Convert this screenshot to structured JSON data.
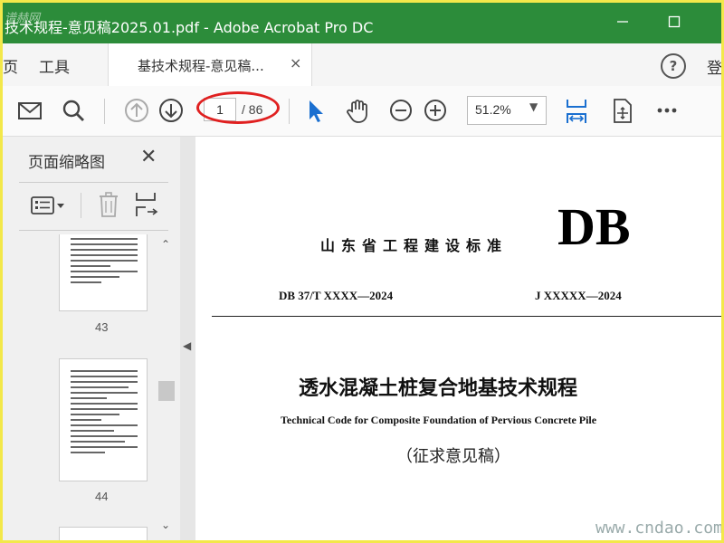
{
  "window": {
    "title": "技术规程-意见稿2025.01.pdf - Adobe Acrobat Pro DC",
    "watermark_top": "谱赫网"
  },
  "tabs": {
    "home": "页",
    "tools": "工具",
    "document": "基技术规程-意见稿...",
    "close": "×",
    "help": "?",
    "login": "登"
  },
  "toolbar": {
    "page_current": "1",
    "page_total": "/ 86",
    "zoom": "51.2%"
  },
  "left_panel": {
    "title": "页面缩略图",
    "pages": [
      "43",
      "44"
    ]
  },
  "document": {
    "org": "山东省工程建设标准",
    "db": "DB",
    "code_left": "DB 37/T XXXX—2024",
    "code_right": "J XXXXX—2024",
    "title_cn": "透水混凝土桩复合地基技术规程",
    "title_en": "Technical Code for Composite Foundation of Pervious Concrete Pile",
    "draft": "（征求意见稿）"
  },
  "watermark_bottom": "www.cndao.com",
  "colors": {
    "titlebar": "#2c8c3a",
    "accent_blue": "#1a6fd0",
    "highlight_oval": "#e02020"
  }
}
